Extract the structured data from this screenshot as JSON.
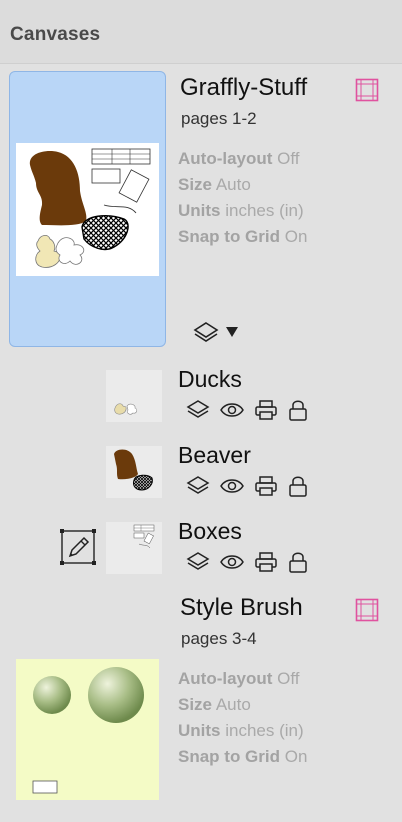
{
  "panel": {
    "title": "Canvases"
  },
  "canvases": [
    {
      "name": "Graffly-Stuff",
      "pages": "pages 1-2",
      "props": [
        {
          "label": "Auto-layout",
          "value": "Off"
        },
        {
          "label": "Size",
          "value": "Auto"
        },
        {
          "label": "Units",
          "value": "inches (in)"
        },
        {
          "label": "Snap to Grid",
          "value": "On"
        }
      ]
    },
    {
      "name": "Style Brush",
      "pages": "pages 3-4",
      "props": [
        {
          "label": "Auto-layout",
          "value": "Off"
        },
        {
          "label": "Size",
          "value": "Auto"
        },
        {
          "label": "Units",
          "value": "inches (in)"
        },
        {
          "label": "Snap to Grid",
          "value": "On"
        }
      ]
    }
  ],
  "layers": [
    {
      "name": "Ducks"
    },
    {
      "name": "Beaver"
    },
    {
      "name": "Boxes"
    }
  ],
  "colors": {
    "selection": "#b9d6f7",
    "brown": "#6b3a0b",
    "page_icon": "#e0529f"
  }
}
